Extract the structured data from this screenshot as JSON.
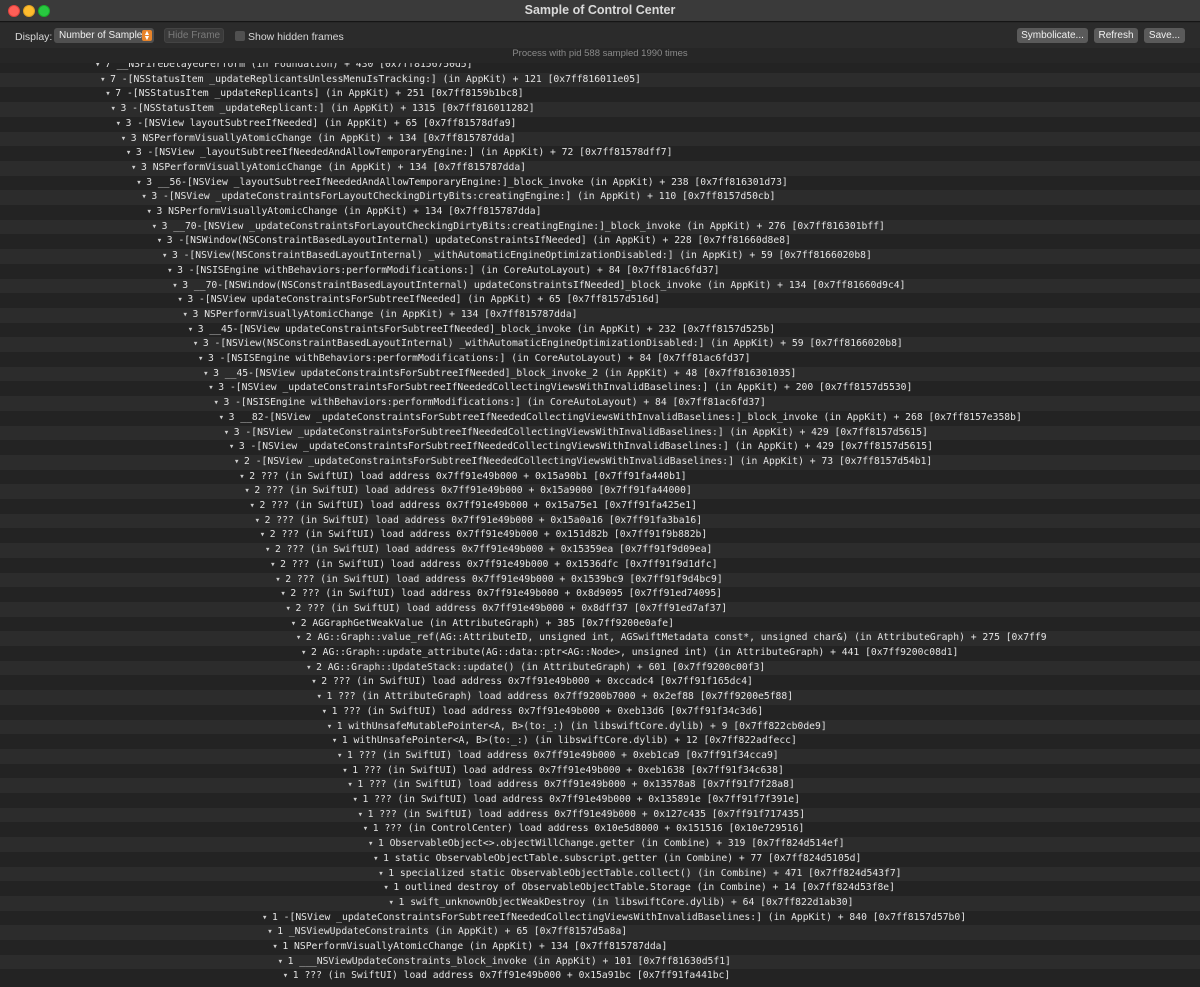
{
  "window": {
    "title": "Sample of Control Center"
  },
  "toolbar": {
    "display_label": "Display:",
    "display_value": "Number of Samples",
    "hide_frame_label": "Hide Frame",
    "show_hidden_label": "Show hidden frames",
    "symbolicate_label": "Symbolicate...",
    "refresh_label": "Refresh",
    "save_label": "Save..."
  },
  "status_text": "Process with pid 588 sampled 1990 times",
  "tree": {
    "rows": [
      {
        "text": "7 __NSFireDelayedPerform  (in Foundation) + 430  [0x7ff8156750d5]"
      },
      {
        "text": "7 -[NSStatusItem _updateReplicantsUnlessMenuIsTracking:]  (in AppKit) + 121  [0x7ff816011e05]"
      },
      {
        "text": "7 -[NSStatusItem _updateReplicants]  (in AppKit) + 251  [0x7ff8159b1bc8]"
      },
      {
        "text": "3 -[NSStatusItem _updateReplicant:]  (in AppKit) + 1315  [0x7ff816011282]"
      },
      {
        "text": "3 -[NSView layoutSubtreeIfNeeded]  (in AppKit) + 65  [0x7ff81578dfa9]"
      },
      {
        "text": "3 NSPerformVisuallyAtomicChange  (in AppKit) + 134  [0x7ff815787dda]"
      },
      {
        "text": "3 -[NSView _layoutSubtreeIfNeededAndAllowTemporaryEngine:]  (in AppKit) + 72  [0x7ff81578dff7]"
      },
      {
        "text": "3 NSPerformVisuallyAtomicChange  (in AppKit) + 134  [0x7ff815787dda]"
      },
      {
        "text": "3 __56-[NSView _layoutSubtreeIfNeededAndAllowTemporaryEngine:]_block_invoke  (in AppKit) + 238  [0x7ff816301d73]"
      },
      {
        "text": "3 -[NSView _updateConstraintsForLayoutCheckingDirtyBits:creatingEngine:]  (in AppKit) + 110  [0x7ff8157d50cb]"
      },
      {
        "text": "3 NSPerformVisuallyAtomicChange  (in AppKit) + 134  [0x7ff815787dda]"
      },
      {
        "text": "3 __70-[NSView _updateConstraintsForLayoutCheckingDirtyBits:creatingEngine:]_block_invoke  (in AppKit) + 276  [0x7ff816301bff]"
      },
      {
        "text": "3 -[NSWindow(NSConstraintBasedLayoutInternal) updateConstraintsIfNeeded]  (in AppKit) + 228  [0x7ff81660d8e8]"
      },
      {
        "text": "3 -[NSView(NSConstraintBasedLayoutInternal) _withAutomaticEngineOptimizationDisabled:]  (in AppKit) + 59  [0x7ff8166020b8]"
      },
      {
        "text": "3 -[NSISEngine withBehaviors:performModifications:]  (in CoreAutoLayout) + 84  [0x7ff81ac6fd37]"
      },
      {
        "text": "3 __70-[NSWindow(NSConstraintBasedLayoutInternal) updateConstraintsIfNeeded]_block_invoke  (in AppKit) + 134  [0x7ff81660d9c4]"
      },
      {
        "text": "3 -[NSView updateConstraintsForSubtreeIfNeeded]  (in AppKit) + 65  [0x7ff8157d516d]"
      },
      {
        "text": "3 NSPerformVisuallyAtomicChange  (in AppKit) + 134  [0x7ff815787dda]"
      },
      {
        "text": "3 __45-[NSView updateConstraintsForSubtreeIfNeeded]_block_invoke  (in AppKit) + 232  [0x7ff8157d525b]"
      },
      {
        "text": "3 -[NSView(NSConstraintBasedLayoutInternal) _withAutomaticEngineOptimizationDisabled:]  (in AppKit) + 59  [0x7ff8166020b8]"
      },
      {
        "text": "3 -[NSISEngine withBehaviors:performModifications:]  (in CoreAutoLayout) + 84  [0x7ff81ac6fd37]"
      },
      {
        "text": "3 __45-[NSView updateConstraintsForSubtreeIfNeeded]_block_invoke_2  (in AppKit) + 48  [0x7ff816301035]"
      },
      {
        "text": "3 -[NSView _updateConstraintsForSubtreeIfNeededCollectingViewsWithInvalidBaselines:]  (in AppKit) + 200  [0x7ff8157d5530]"
      },
      {
        "text": "3 -[NSISEngine withBehaviors:performModifications:]  (in CoreAutoLayout) + 84  [0x7ff81ac6fd37]"
      },
      {
        "text": "3 __82-[NSView _updateConstraintsForSubtreeIfNeededCollectingViewsWithInvalidBaselines:]_block_invoke  (in AppKit) + 268  [0x7ff8157e358b]"
      },
      {
        "text": "3 -[NSView _updateConstraintsForSubtreeIfNeededCollectingViewsWithInvalidBaselines:]  (in AppKit) + 429  [0x7ff8157d5615]"
      },
      {
        "text": "3 -[NSView _updateConstraintsForSubtreeIfNeededCollectingViewsWithInvalidBaselines:]  (in AppKit) + 429  [0x7ff8157d5615]"
      },
      {
        "text": "2 -[NSView _updateConstraintsForSubtreeIfNeededCollectingViewsWithInvalidBaselines:]  (in AppKit) + 73  [0x7ff8157d54b1]"
      },
      {
        "text": "2 ???  (in SwiftUI)  load address 0x7ff91e49b000 + 0x15a90b1  [0x7ff91fa440b1]"
      },
      {
        "text": "2 ???  (in SwiftUI)  load address 0x7ff91e49b000 + 0x15a9000  [0x7ff91fa44000]"
      },
      {
        "text": "2 ???  (in SwiftUI)  load address 0x7ff91e49b000 + 0x15a75e1  [0x7ff91fa425e1]"
      },
      {
        "text": "2 ???  (in SwiftUI)  load address 0x7ff91e49b000 + 0x15a0a16  [0x7ff91fa3ba16]"
      },
      {
        "text": "2 ???  (in SwiftUI)  load address 0x7ff91e49b000 + 0x151d82b  [0x7ff91f9b882b]"
      },
      {
        "text": "2 ???  (in SwiftUI)  load address 0x7ff91e49b000 + 0x15359ea  [0x7ff91f9d09ea]"
      },
      {
        "text": "2 ???  (in SwiftUI)  load address 0x7ff91e49b000 + 0x1536dfc  [0x7ff91f9d1dfc]"
      },
      {
        "text": "2 ???  (in SwiftUI)  load address 0x7ff91e49b000 + 0x1539bc9  [0x7ff91f9d4bc9]"
      },
      {
        "text": "2 ???  (in SwiftUI)  load address 0x7ff91e49b000 + 0x8d9095  [0x7ff91ed74095]"
      },
      {
        "text": "2 ???  (in SwiftUI)  load address 0x7ff91e49b000 + 0x8dff37  [0x7ff91ed7af37]"
      },
      {
        "text": "2 AGGraphGetWeakValue  (in AttributeGraph) + 385  [0x7ff9200e0afe]"
      },
      {
        "text": "2 AG::Graph::value_ref(AG::AttributeID, unsigned int, AGSwiftMetadata const*, unsigned char&)  (in AttributeGraph) + 275  [0x7ff9"
      },
      {
        "text": "2 AG::Graph::update_attribute(AG::data::ptr<AG::Node>, unsigned int)  (in AttributeGraph) + 441  [0x7ff9200c08d1]"
      },
      {
        "text": "2 AG::Graph::UpdateStack::update()  (in AttributeGraph) + 601  [0x7ff9200c00f3]"
      },
      {
        "text": "2 ???  (in SwiftUI)  load address 0x7ff91e49b000 + 0xccadc4  [0x7ff91f165dc4]"
      },
      {
        "text": "1 ???  (in AttributeGraph)  load address 0x7ff9200b7000 + 0x2ef88  [0x7ff9200e5f88]"
      },
      {
        "text": "1 ???  (in SwiftUI)  load address 0x7ff91e49b000 + 0xeb13d6  [0x7ff91f34c3d6]"
      },
      {
        "text": "1 withUnsafeMutablePointer<A, B>(to:_:)  (in libswiftCore.dylib) + 9  [0x7ff822cb0de9]"
      },
      {
        "text": "1 withUnsafePointer<A, B>(to:_:)  (in libswiftCore.dylib) + 12  [0x7ff822adfecc]"
      },
      {
        "text": "1 ???  (in SwiftUI)  load address 0x7ff91e49b000 + 0xeb1ca9  [0x7ff91f34cca9]"
      },
      {
        "text": "1 ???  (in SwiftUI)  load address 0x7ff91e49b000 + 0xeb1638  [0x7ff91f34c638]"
      },
      {
        "text": "1 ???  (in SwiftUI)  load address 0x7ff91e49b000 + 0x13578a8  [0x7ff91f7f28a8]"
      },
      {
        "text": "1 ???  (in SwiftUI)  load address 0x7ff91e49b000 + 0x135891e  [0x7ff91f7f391e]"
      },
      {
        "text": "1 ???  (in SwiftUI)  load address 0x7ff91e49b000 + 0x127c435  [0x7ff91f717435]"
      },
      {
        "text": "1 ???  (in ControlCenter)  load address 0x10e5d8000 + 0x151516  [0x10e729516]"
      },
      {
        "text": "1 ObservableObject<>.objectWillChange.getter  (in Combine) + 319  [0x7ff824d514ef]"
      },
      {
        "text": "1 static ObservableObjectTable.subscript.getter  (in Combine) + 77  [0x7ff824d5105d]"
      },
      {
        "text": "1 specialized static ObservableObjectTable.collect()  (in Combine) + 471  [0x7ff824d543f7]"
      },
      {
        "text": "1 outlined destroy of ObservableObjectTable.Storage  (in Combine) + 14  [0x7ff824d53f8e]"
      },
      {
        "text": "1 swift_unknownObjectWeakDestroy  (in libswiftCore.dylib) + 64  [0x7ff822d1ab30]"
      },
      {
        "text": "1 -[NSView _updateConstraintsForSubtreeIfNeededCollectingViewsWithInvalidBaselines:]  (in AppKit) + 840  [0x7ff8157d57b0]"
      },
      {
        "text": "1 _NSViewUpdateConstraints  (in AppKit) + 65  [0x7ff8157d5a8a]"
      },
      {
        "text": "1 NSPerformVisuallyAtomicChange  (in AppKit) + 134  [0x7ff815787dda]"
      },
      {
        "text": "1 ___NSViewUpdateConstraints_block_invoke  (in AppKit) + 101  [0x7ff81630d5f1]"
      },
      {
        "text": "1 ???  (in SwiftUI)  load address 0x7ff91e49b000 + 0x15a91bc  [0x7ff91fa441bc]"
      }
    ]
  }
}
